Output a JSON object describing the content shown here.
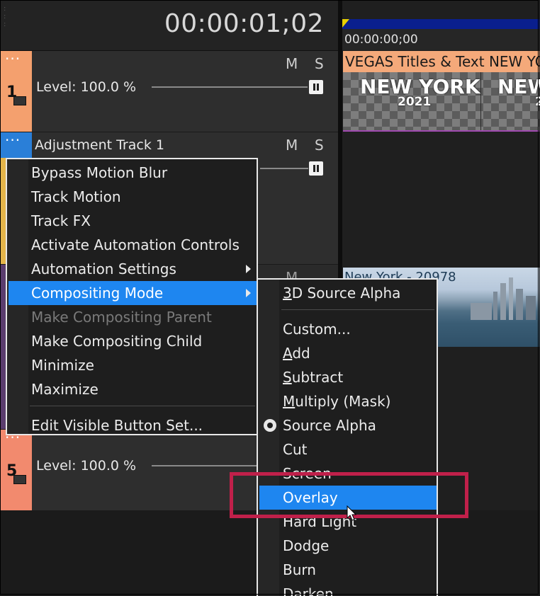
{
  "timecode": "00:00:01;02",
  "ruler": {
    "time": "00:00:00;00"
  },
  "tracks": [
    {
      "number": "1",
      "color": "#f4a06e",
      "level": "Level: 100.0 %",
      "mute": "M",
      "solo": "S"
    },
    {
      "name": "Adjustment Track 1",
      "color": "#2a7fd8",
      "mute": "M",
      "solo": "S"
    },
    {
      "number": "5",
      "color": "#f28a6e",
      "level": "Level: 100.0 %"
    }
  ],
  "title_clip": {
    "bar_text": "VEGAS Titles & Text NEW YO",
    "big": "NEW YORK",
    "small": "2021",
    "big_cut": "NEW",
    "small_cut": "2"
  },
  "video_clip": {
    "label": "New York - 20978"
  },
  "context_menu": {
    "items": [
      {
        "label": "Bypass Motion Blur"
      },
      {
        "label": "Track Motion"
      },
      {
        "label": "Track FX"
      },
      {
        "label": "Activate Automation Controls"
      },
      {
        "label": "Automation Settings",
        "submenu": true
      },
      {
        "label": "Compositing Mode",
        "submenu": true,
        "selected": true
      },
      {
        "label": "Make Compositing Parent",
        "disabled": true
      },
      {
        "label": "Make Compositing Child"
      },
      {
        "label": "Minimize"
      },
      {
        "label": "Maximize"
      },
      {
        "label": "Edit Visible Button Set..."
      }
    ]
  },
  "compositing_submenu": {
    "items": [
      {
        "label": "3D Source Alpha",
        "mnemonic": "3"
      },
      {
        "label": "Custom..."
      },
      {
        "label": "Add",
        "mnemonic": "A"
      },
      {
        "label": "Subtract",
        "mnemonic": "S"
      },
      {
        "label": "Multiply (Mask)",
        "mnemonic": "M"
      },
      {
        "label": "Source Alpha",
        "checked": true
      },
      {
        "label": "Cut"
      },
      {
        "label": "Screen"
      },
      {
        "label": "Overlay",
        "selected": true
      },
      {
        "label": "Hard Light"
      },
      {
        "label": "Dodge"
      },
      {
        "label": "Burn"
      },
      {
        "label": "Darken"
      }
    ]
  },
  "colors": {
    "accent": "#1e86f0",
    "highlight_box": "#c0204a",
    "track1": "#f4a06e",
    "track5": "#f28a6e",
    "title_bar": "#f4a97a"
  }
}
